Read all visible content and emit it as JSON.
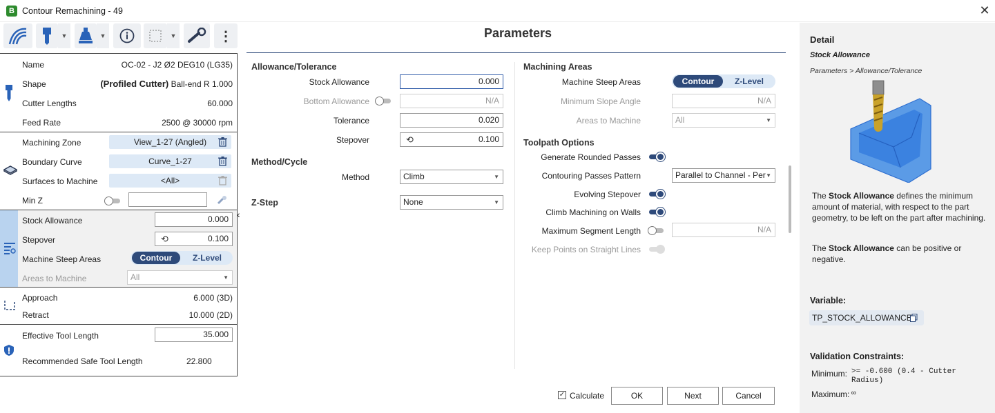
{
  "window": {
    "app_icon": "B",
    "title": "Contour Remachining - 49",
    "close": "✕"
  },
  "toolbar": {
    "buttons": [
      "toolpath-icon",
      "tool-icon",
      "holder-icon",
      "info-icon",
      "stock-icon",
      "wrench-icon",
      "more-icon"
    ],
    "info_glyph": "i",
    "more_glyph": "⋮"
  },
  "left": {
    "tool": {
      "name_label": "Name",
      "name_value": "OC-02 - J2 Ø2 DEG10 (LG35)",
      "shape_label": "Shape",
      "shape_bold": "(Profiled Cutter)",
      "shape_rest": "Ball-end R 1.000",
      "cutter_label": "Cutter Lengths",
      "cutter_value": "60.000",
      "feed_label": "Feed Rate",
      "feed_value": "2500 @ 30000 rpm"
    },
    "zone": {
      "zone_label": "Machining Zone",
      "zone_value": "View_1-27 (Angled)",
      "boundary_label": "Boundary Curve",
      "boundary_value": "Curve_1-27",
      "surfaces_label": "Surfaces to Machine",
      "surfaces_value": "<All>",
      "minz_label": "Min Z"
    },
    "params": {
      "stock_label": "Stock Allowance",
      "stock_value": "0.000",
      "stepover_label": "Stepover",
      "stepover_value": "0.100",
      "steep_label": "Machine Steep Areas",
      "seg_on": "Contour",
      "seg_off": "Z-Level",
      "areas_label": "Areas to Machine",
      "areas_value": "All"
    },
    "links": {
      "approach_label": "Approach",
      "approach_value": "6.000 (3D)",
      "retract_label": "Retract",
      "retract_value": "10.000 (2D)"
    },
    "safety": {
      "eff_label": "Effective Tool Length",
      "eff_value": "35.000",
      "rec_label": "Recommended Safe Tool Length",
      "rec_value": "22.800"
    },
    "collapse_glyph": "‹"
  },
  "center": {
    "title": "Parameters",
    "allowance": {
      "heading": "Allowance/Tolerance",
      "stock_label": "Stock Allowance",
      "stock_value": "0.000",
      "bottom_label": "Bottom Allowance",
      "bottom_value": "N/A",
      "tol_label": "Tolerance",
      "tol_value": "0.020",
      "step_label": "Stepover",
      "step_value": "0.100"
    },
    "method": {
      "heading": "Method/Cycle",
      "label": "Method",
      "value": "Climb"
    },
    "zstep": {
      "heading": "Z-Step",
      "value": "None"
    },
    "areas": {
      "heading": "Machining Areas",
      "steep_label": "Machine Steep Areas",
      "seg_on": "Contour",
      "seg_off": "Z-Level",
      "slope_label": "Minimum Slope Angle",
      "slope_value": "N/A",
      "areas_label": "Areas to Machine",
      "areas_value": "All"
    },
    "toolpath": {
      "heading": "Toolpath Options",
      "rounded_label": "Generate Rounded Passes",
      "pattern_label": "Contouring Passes Pattern",
      "pattern_value": "Parallel to Channel - Per",
      "evolving_label": "Evolving Stepover",
      "climb_label": "Climb Machining on Walls",
      "maxseg_label": "Maximum Segment Length",
      "maxseg_value": "N/A",
      "keep_label": "Keep Points on Straight Lines"
    },
    "footer": {
      "calculate": "Calculate",
      "check": "✓",
      "ok": "OK",
      "next": "Next",
      "cancel": "Cancel"
    }
  },
  "detail": {
    "heading": "Detail",
    "subject": "Stock Allowance",
    "breadcrumb": "Parameters > Allowance/Tolerance",
    "p1_a": "The ",
    "p1_b": "Stock Allowance",
    "p1_c": " defines the minimum amount of material, with respect to the part geometry, to be left on the part after machining.",
    "p2_a": "The ",
    "p2_b": "Stock Allowance",
    "p2_c": " can be positive or negative.",
    "variable_label": "Variable:",
    "variable_value": "TP_STOCK_ALLOWANCE",
    "validation_label": "Validation Constraints:",
    "min_label": "Minimum:",
    "min_value": ">= -0.600 (0.4 - Cutter Radius)",
    "max_label": "Maximum:",
    "max_value": "∞"
  },
  "colors": {
    "accent": "#2e4a7a",
    "chip": "#dde9f6",
    "panel_bg": "#f2f2f2"
  }
}
